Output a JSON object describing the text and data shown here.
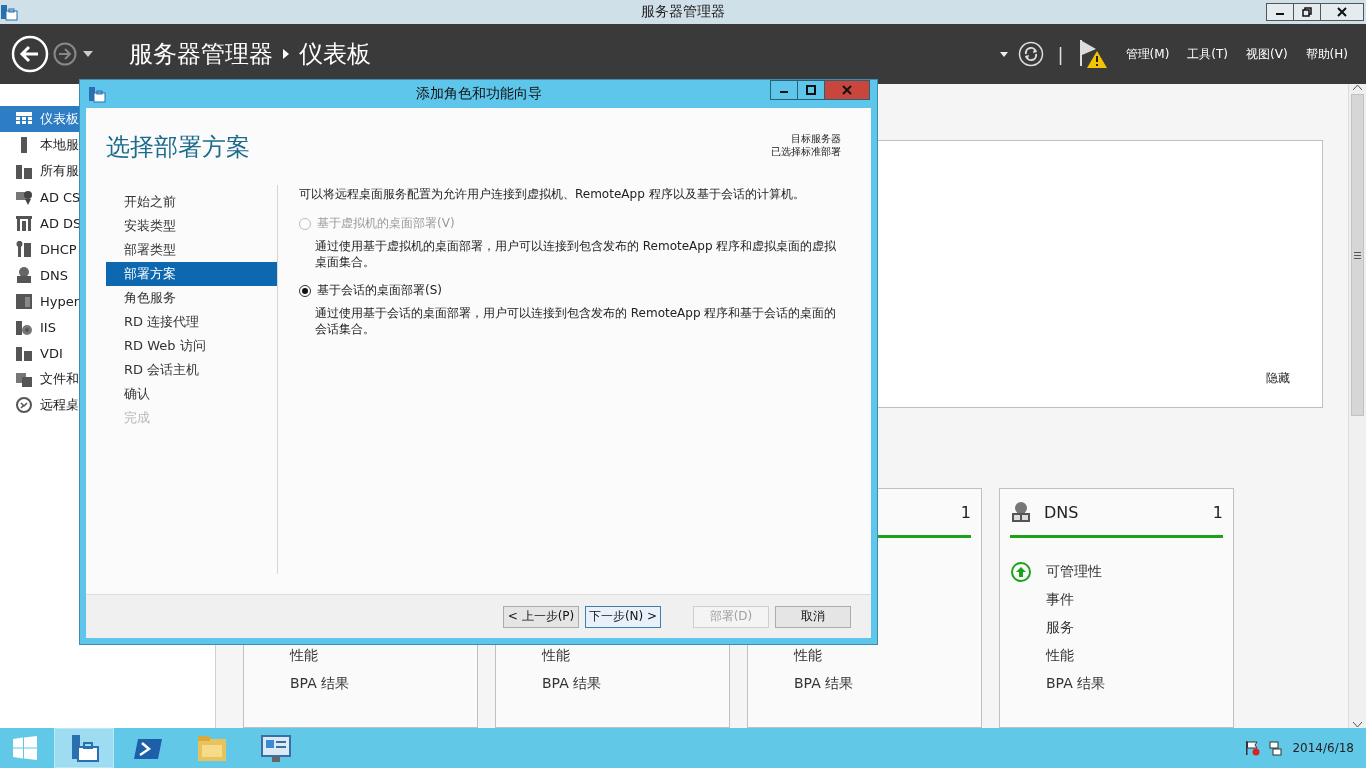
{
  "window": {
    "title": "服务器管理器"
  },
  "header": {
    "breadcrumb": [
      "服务器管理器",
      "仪表板"
    ],
    "separator": "|",
    "menus": [
      "管理(M)",
      "工具(T)",
      "视图(V)",
      "帮助(H)"
    ]
  },
  "sidebar": {
    "items": [
      {
        "label": "仪表板",
        "selected": true
      },
      {
        "label": "本地服",
        "selected": false
      },
      {
        "label": "所有服",
        "selected": false
      },
      {
        "label": "AD CS",
        "selected": false
      },
      {
        "label": "AD DS",
        "selected": false
      },
      {
        "label": "DHCP",
        "selected": false
      },
      {
        "label": "DNS",
        "selected": false
      },
      {
        "label": "Hyper",
        "selected": false
      },
      {
        "label": "IIS",
        "selected": false
      },
      {
        "label": "VDI",
        "selected": false
      },
      {
        "label": "文件和",
        "selected": false
      },
      {
        "label": "远程桌",
        "selected": false
      }
    ]
  },
  "panel": {
    "hide_link": "隐藏"
  },
  "tiles": [
    {
      "items": [
        {
          "label": "性能"
        },
        {
          "label": "BPA 结果"
        }
      ]
    },
    {
      "items": [
        {
          "label": "性能"
        },
        {
          "label": "BPA 结果"
        }
      ]
    },
    {
      "count": "1",
      "items": [
        {
          "label": "性能"
        },
        {
          "label": "BPA 结果"
        }
      ]
    },
    {
      "title": "DNS",
      "count": "1",
      "items": [
        {
          "label": "可管理性",
          "healthy": true
        },
        {
          "label": "事件"
        },
        {
          "label": "服务"
        },
        {
          "label": "性能"
        },
        {
          "label": "BPA 结果"
        }
      ]
    }
  ],
  "wizard": {
    "title": "添加角色和功能向导",
    "heading": "选择部署方案",
    "target_label": "目标服务器",
    "target_value": "已选择标准部署",
    "steps": [
      {
        "label": "开始之前",
        "selected": false,
        "disabled": false
      },
      {
        "label": "安装类型",
        "selected": false,
        "disabled": false
      },
      {
        "label": "部署类型",
        "selected": false,
        "disabled": false
      },
      {
        "label": "部署方案",
        "selected": true,
        "disabled": false
      },
      {
        "label": "角色服务",
        "selected": false,
        "disabled": false
      },
      {
        "label": "RD 连接代理",
        "selected": false,
        "disabled": false
      },
      {
        "label": "RD Web 访问",
        "selected": false,
        "disabled": false
      },
      {
        "label": "RD 会话主机",
        "selected": false,
        "disabled": false
      },
      {
        "label": "确认",
        "selected": false,
        "disabled": false
      },
      {
        "label": "完成",
        "selected": false,
        "disabled": true
      }
    ],
    "intro": "可以将远程桌面服务配置为允许用户连接到虚拟机、RemoteApp 程序以及基于会话的计算机。",
    "options": [
      {
        "label": "基于虚拟机的桌面部署(V)",
        "description": "通过使用基于虚拟机的桌面部署，用户可以连接到包含发布的 RemoteApp 程序和虚拟桌面的虚拟桌面集合。",
        "selected": false,
        "disabled": true
      },
      {
        "label": "基于会话的桌面部署(S)",
        "description": "通过使用基于会话的桌面部署，用户可以连接到包含发布的 RemoteApp 程序和基于会话的桌面的会话集合。",
        "selected": true,
        "disabled": false
      }
    ],
    "buttons": [
      {
        "label": "< 上一步(P)",
        "disabled": false,
        "focused": false
      },
      {
        "label": "下一步(N) >",
        "disabled": false,
        "focused": true
      },
      {
        "label": "部署(D)",
        "disabled": true,
        "focused": false
      },
      {
        "label": "取消",
        "disabled": false,
        "focused": false
      }
    ]
  },
  "taskbar": {
    "apps": [
      {
        "selected": true
      },
      {
        "selected": false
      },
      {
        "selected": false
      },
      {
        "selected": false
      }
    ],
    "date": "2014/6/18"
  }
}
